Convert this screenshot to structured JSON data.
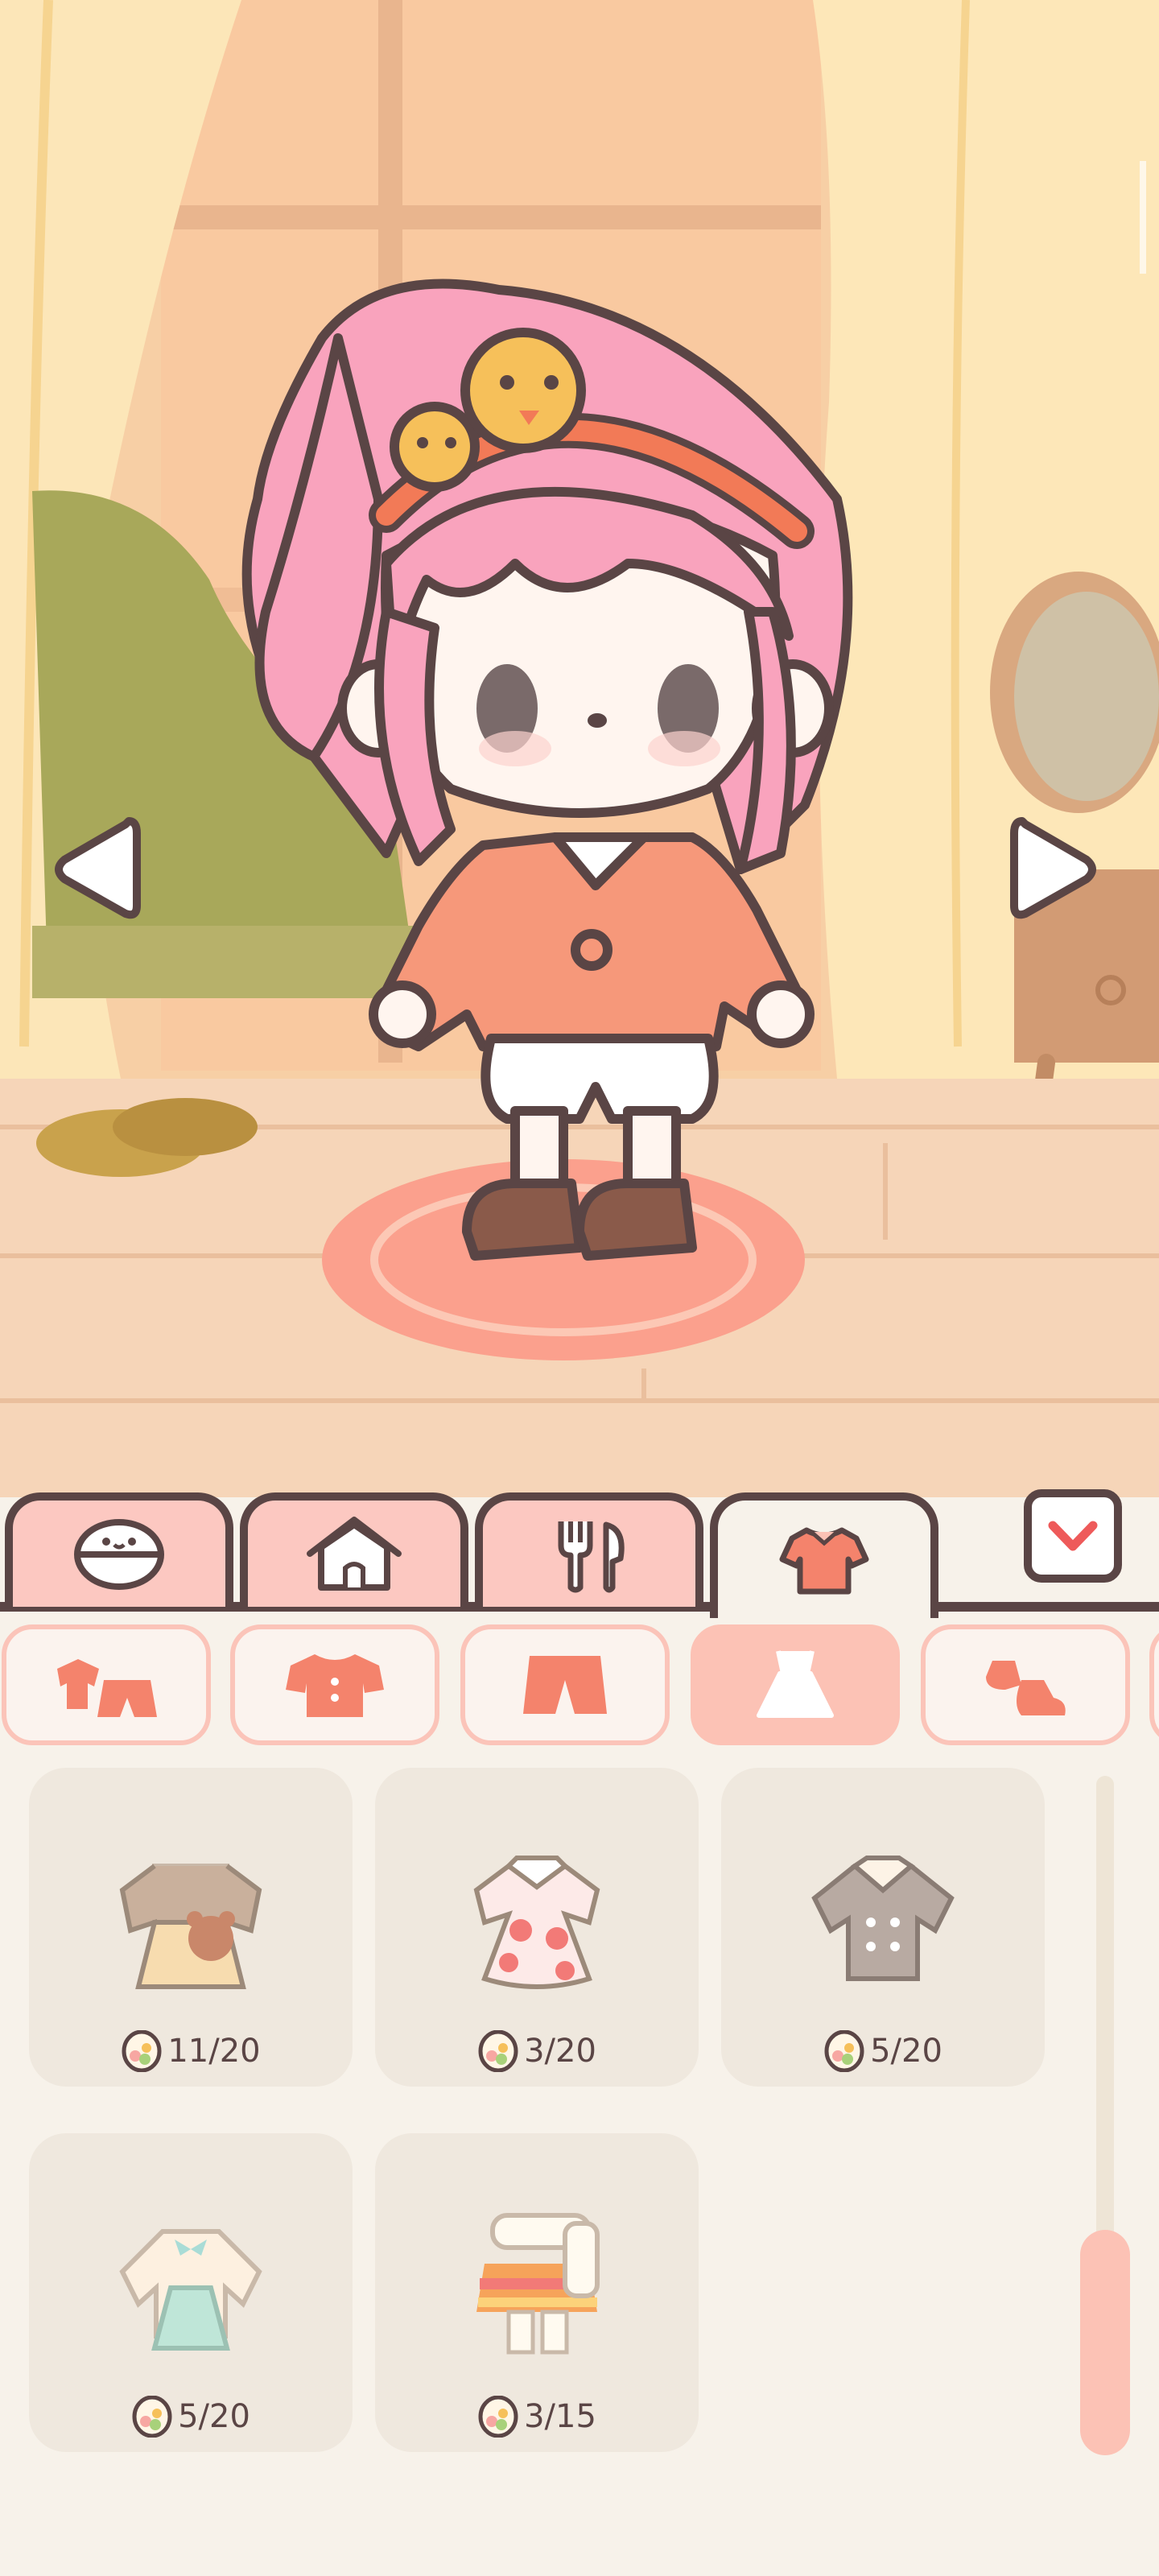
{
  "scene": {
    "description_icons": [
      "character-doll",
      "window",
      "curtains",
      "armchair",
      "vanity-mirror",
      "rug",
      "slippers"
    ],
    "prev_icon": "left-arrow-icon",
    "next_icon": "right-arrow-icon"
  },
  "tabs": [
    {
      "name": "face",
      "icon": "face-icon",
      "active": false
    },
    {
      "name": "home",
      "icon": "house-icon",
      "active": false
    },
    {
      "name": "food",
      "icon": "fork-knife-icon",
      "active": false
    },
    {
      "name": "clothes",
      "icon": "shirt-icon",
      "active": true
    }
  ],
  "collapse_icon": "chevron-down-icon",
  "categories": [
    {
      "name": "outfit-set",
      "icon": "outfit-set-icon",
      "active": false
    },
    {
      "name": "tops",
      "icon": "top-shirt-icon",
      "active": false
    },
    {
      "name": "bottoms",
      "icon": "shorts-icon",
      "active": false
    },
    {
      "name": "dresses",
      "icon": "dress-icon",
      "active": true
    },
    {
      "name": "shoes",
      "icon": "shoes-icon",
      "active": false
    }
  ],
  "items": [
    {
      "name": "bear-bag-dress",
      "count": "11/20"
    },
    {
      "name": "strawberry-dress",
      "count": "3/20"
    },
    {
      "name": "gray-coat",
      "count": "5/20"
    },
    {
      "name": "mint-cardigan-dress",
      "count": "5/20"
    },
    {
      "name": "stripe-scarf-outfit",
      "count": "3/15"
    }
  ],
  "colors": {
    "accent": "#fcc2b5",
    "outline": "#5a4545",
    "panel": "#f7f2ea",
    "card": "#efe8de",
    "icon": "#f4836c"
  }
}
